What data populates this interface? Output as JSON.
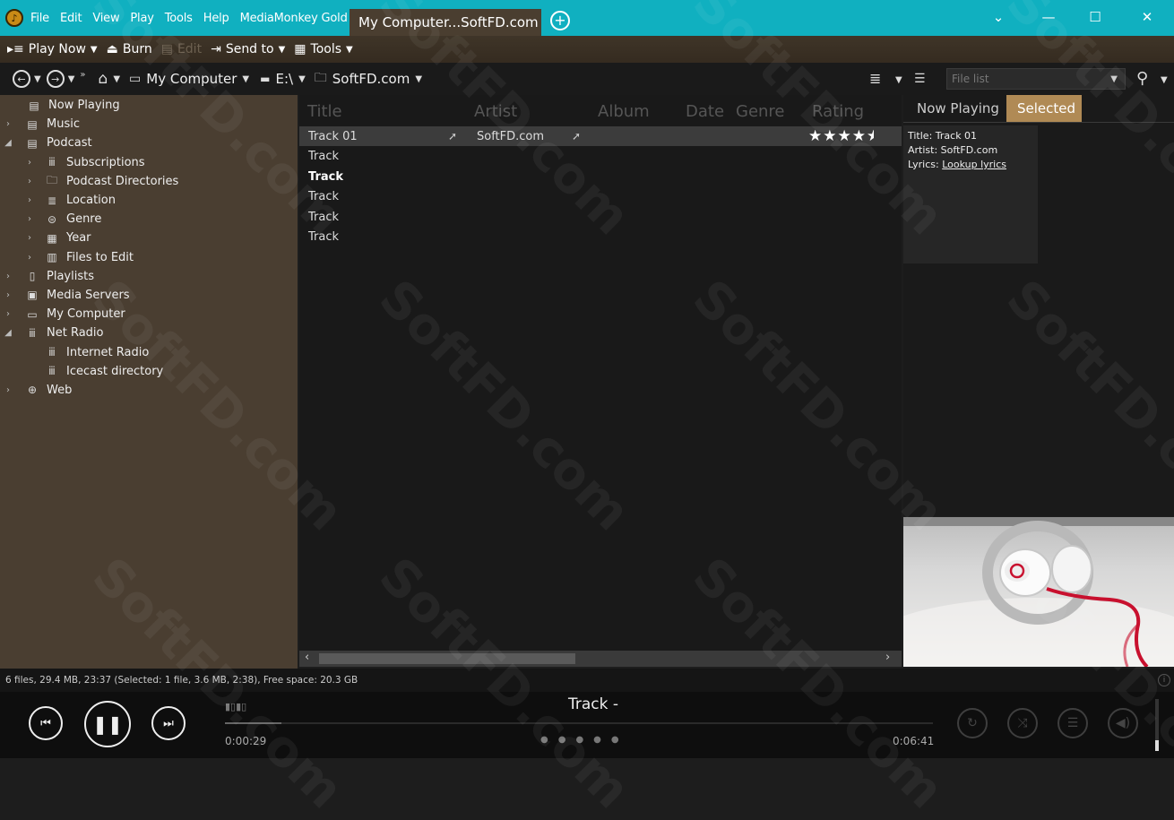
{
  "menu": [
    "File",
    "Edit",
    "View",
    "Play",
    "Tools",
    "Help",
    "MediaMonkey Gold"
  ],
  "tab_title": "My Computer...SoftFD.com",
  "window_controls": {
    "minimize": "—",
    "maximize": "☐",
    "close": "✕",
    "dropdown": "⌄"
  },
  "toolbar": {
    "play_now": "Play Now",
    "burn": "Burn",
    "edit": "Edit",
    "send_to": "Send to",
    "tools": "Tools"
  },
  "breadcrumb": {
    "computer": "My Computer",
    "drive": "E:\\",
    "folder": "SoftFD.com"
  },
  "filelist_placeholder": "File list",
  "tree": {
    "now_playing": "Now Playing",
    "music": "Music",
    "podcast": "Podcast",
    "subscriptions": "Subscriptions",
    "podcast_directories": "Podcast Directories",
    "location": "Location",
    "genre": "Genre",
    "year": "Year",
    "files_to_edit": "Files to Edit",
    "playlists": "Playlists",
    "media_servers": "Media Servers",
    "my_computer": "My Computer",
    "net_radio": "Net Radio",
    "internet_radio": "Internet Radio",
    "icecast_directory": "Icecast directory",
    "web": "Web"
  },
  "columns": [
    "Title",
    "Artist",
    "Album",
    "Date",
    "Genre",
    "Rating"
  ],
  "tracks": [
    {
      "title": "Track 01",
      "artist": "SoftFD.com",
      "rating": 4.5
    },
    {
      "title": "Track",
      "artist": ""
    },
    {
      "title": "Track",
      "artist": ""
    },
    {
      "title": "Track",
      "artist": ""
    },
    {
      "title": "Track",
      "artist": ""
    },
    {
      "title": "Track",
      "artist": ""
    }
  ],
  "right_tabs": {
    "now_playing": "Now Playing",
    "selected": "Selected"
  },
  "info": {
    "title_label": "Title:",
    "title_value": "Track 01",
    "artist_label": "Artist:",
    "artist_value": "SoftFD.com",
    "lyrics_label": "Lyrics:",
    "lyrics_link": "Lookup lyrics"
  },
  "status": "6 files, 29.4 MB, 23:37 (Selected: 1 file, 3.6 MB, 2:38), Free space: 20.3 GB",
  "player": {
    "now_playing_title": "Track -",
    "elapsed": "0:00:29",
    "total": "0:06:41",
    "progress": 0.08,
    "volume": 0.2
  },
  "watermark": "SoftFD.com",
  "colors": {
    "accent": "#10b0c0",
    "tab_active": "#b08a55",
    "tree_bg": "#4a3e31"
  }
}
